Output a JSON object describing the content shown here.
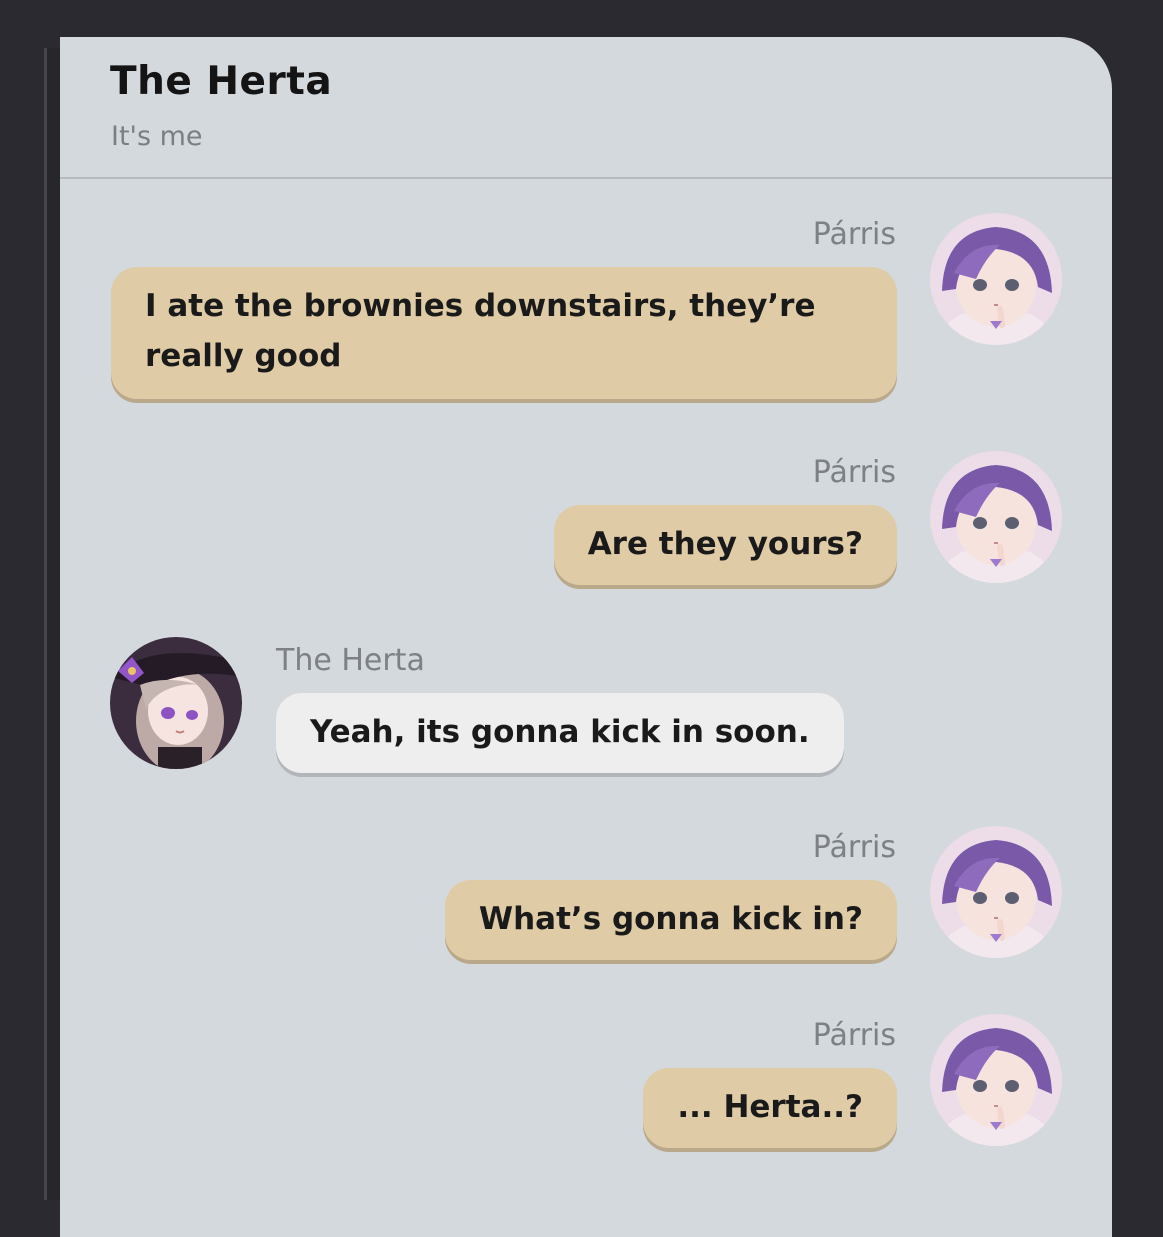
{
  "chat": {
    "title": "The Herta",
    "status": "It's me"
  },
  "messages": [
    {
      "sender": "Párris",
      "text": "I ate the brownies downstairs, they’re really good",
      "side": "right",
      "avatar": "parris-avatar"
    },
    {
      "sender": "Párris",
      "text": "Are they yours?",
      "side": "right",
      "avatar": "parris-avatar"
    },
    {
      "sender": "The Herta",
      "text": "Yeah, its gonna kick in soon.",
      "side": "left",
      "avatar": "herta-avatar"
    },
    {
      "sender": "Párris",
      "text": "What’s gonna kick in?",
      "side": "right",
      "avatar": "parris-avatar"
    },
    {
      "sender": "Párris",
      "text": "... Herta..?",
      "side": "right",
      "avatar": "parris-avatar"
    }
  ],
  "colors": {
    "background": "#2b2a30",
    "panel": "#d4d9de",
    "own_bubble": "#dfcba5",
    "other_bubble": "#eeeeef"
  }
}
